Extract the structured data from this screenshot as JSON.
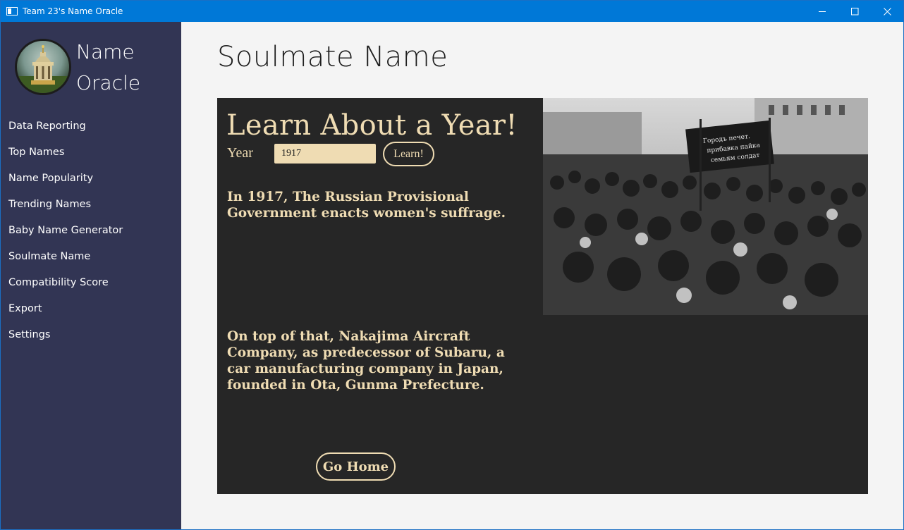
{
  "window": {
    "title": "Team 23's Name Oracle"
  },
  "sidebar": {
    "brand_line1": "Name",
    "brand_line2": "Oracle",
    "items": [
      {
        "label": "Data Reporting"
      },
      {
        "label": "Top Names"
      },
      {
        "label": "Name Popularity"
      },
      {
        "label": "Trending Names"
      },
      {
        "label": "Baby Name Generator"
      },
      {
        "label": "Soulmate Name"
      },
      {
        "label": "Compatibility Score"
      },
      {
        "label": "Export"
      },
      {
        "label": "Settings"
      }
    ]
  },
  "main": {
    "page_title": "Soulmate Name",
    "panel": {
      "heading": "Learn About a Year!",
      "year_label": "Year",
      "year_value": "1917",
      "learn_button": "Learn!",
      "fact_1": "In 1917, The Russian Provisional Government enacts women's suffrage.",
      "fact_2": "On top of that, Nakajima Aircraft Company, as predecessor of Subaru, a car manufacturing company in Japan, founded in Ota, Gunma Prefecture.",
      "home_button": "Go Home"
    }
  },
  "colors": {
    "titlebar": "#0078d7",
    "sidebar": "#323554",
    "panel": "#262626",
    "accent_text": "#efdcb3"
  },
  "icons": [
    "app-icon",
    "minimize-icon",
    "maximize-icon",
    "close-icon",
    "logo"
  ]
}
